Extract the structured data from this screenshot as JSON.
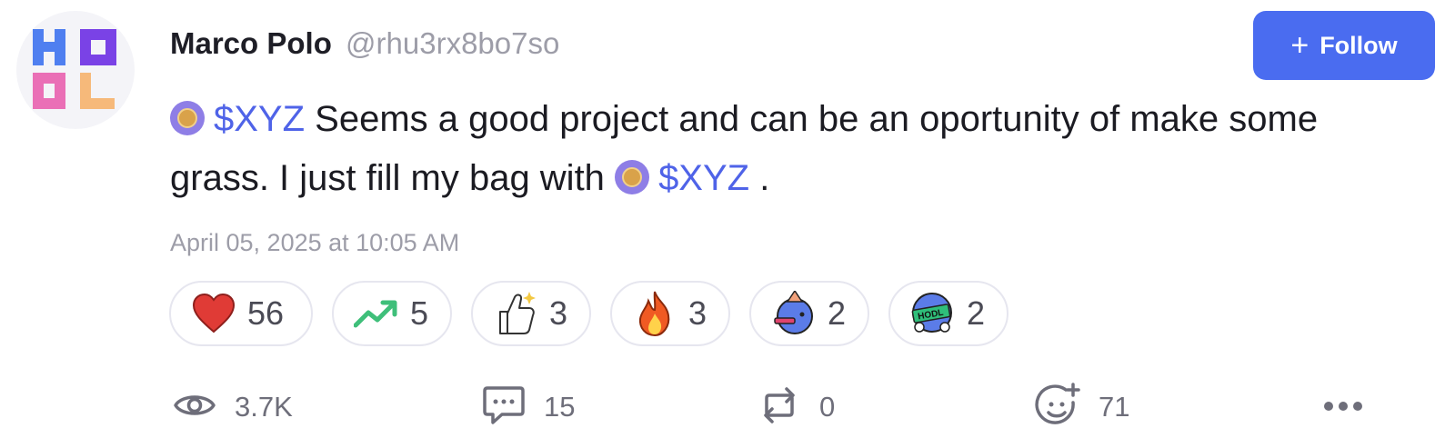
{
  "user": {
    "name": "Marco Polo",
    "handle": "@rhu3rx8bo7so",
    "avatar_letters": "HODL"
  },
  "follow_button": {
    "icon": "plus-icon",
    "label": "Follow"
  },
  "post": {
    "ticker_1": "$XYZ",
    "text_1": "Seems a good project and can be an oportunity of make some grass. I just fill my bag with",
    "ticker_2": "$XYZ",
    "text_2": ".",
    "timestamp": "April 05, 2025 at 10:05 AM"
  },
  "reactions": [
    {
      "icon": "heart-icon",
      "count": "56"
    },
    {
      "icon": "trending-up-icon",
      "count": "5"
    },
    {
      "icon": "thumbs-up-sparkle-icon",
      "count": "3"
    },
    {
      "icon": "fire-icon",
      "count": "3"
    },
    {
      "icon": "party-mascot-icon",
      "count": "2"
    },
    {
      "icon": "hodl-mascot-icon",
      "count": "2"
    }
  ],
  "actions": {
    "views": {
      "icon": "eye-icon",
      "count": "3.7K"
    },
    "comments": {
      "icon": "comment-icon",
      "count": "15"
    },
    "reposts": {
      "icon": "repost-icon",
      "count": "0"
    },
    "add_reaction": {
      "icon": "add-emoji-icon",
      "count": "71"
    },
    "more": {
      "icon": "more-dots-icon"
    }
  },
  "colors": {
    "accent": "#4a6cf0",
    "ticker": "#4f63e8",
    "muted": "#9d9da8"
  }
}
